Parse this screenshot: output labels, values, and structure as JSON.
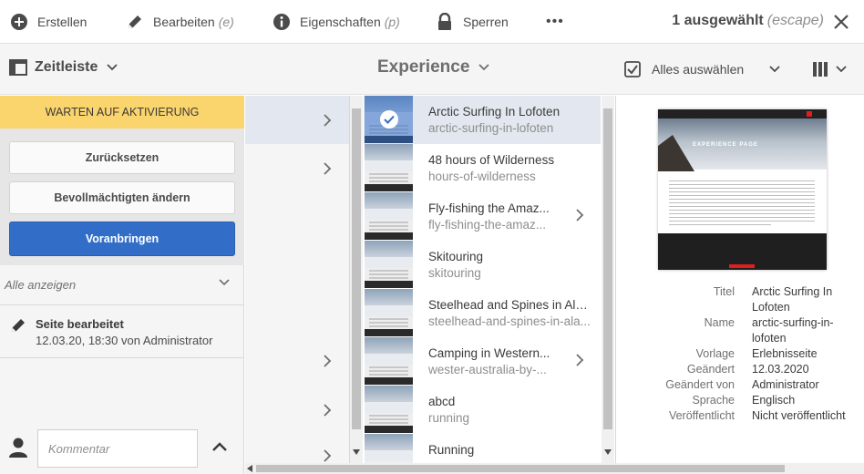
{
  "actions": {
    "create": "Erstellen",
    "edit": "Bearbeiten",
    "edit_shortcut": "(e)",
    "properties": "Eigenschaften",
    "properties_shortcut": "(p)",
    "lock": "Sperren",
    "more": "•••",
    "selection_count": "1 ausgewählt",
    "selection_shortcut": "(escape)"
  },
  "toolbar": {
    "rail_label": "Zeitleiste",
    "title": "Experience",
    "select_all": "Alles auswählen"
  },
  "workflow": {
    "status": "WARTEN AUF AKTIVIERUNG",
    "buttons": [
      "Zurücksetzen",
      "Bevollmächtigten ändern",
      "Voranbringen"
    ]
  },
  "timeline": {
    "filter": "Alle anzeigen",
    "event_title": "Seite bearbeitet",
    "event_detail": "12.03.20, 18:30 von Administrator",
    "comment_placeholder": "Kommentar"
  },
  "pages": [
    {
      "title": "Arctic Surfing In Lofoten",
      "name": "arctic-surfing-in-lofoten",
      "selected": true,
      "has_children": false
    },
    {
      "title": "48 hours of Wilderness",
      "name": "hours-of-wilderness",
      "selected": false,
      "has_children": false
    },
    {
      "title": "Fly-fishing the Amaz...",
      "name": "fly-fishing-the-amaz...",
      "selected": false,
      "has_children": true
    },
    {
      "title": "Skitouring",
      "name": "skitouring",
      "selected": false,
      "has_children": false
    },
    {
      "title": "Steelhead and Spines in Ala...",
      "name": "steelhead-and-spines-in-ala...",
      "selected": false,
      "has_children": false
    },
    {
      "title": "Camping in Western...",
      "name": "wester-australia-by-...",
      "selected": false,
      "has_children": true
    },
    {
      "title": "abcd",
      "name": "running",
      "selected": false,
      "has_children": false
    },
    {
      "title": "Running",
      "name": "",
      "selected": false,
      "has_children": false
    }
  ],
  "preview": {
    "hero_title": "EXPERIENCE PAGE"
  },
  "properties": [
    {
      "key": "Titel",
      "value": "Arctic Surfing In"
    },
    {
      "key": "",
      "value": "Lofoten"
    },
    {
      "key": "Name",
      "value": "arctic-surfing-in-"
    },
    {
      "key": "",
      "value": "lofoten"
    },
    {
      "key": "Vorlage",
      "value": "Erlebnisseite"
    },
    {
      "key": "Geändert",
      "value": "12.03.2020"
    },
    {
      "key": "Geändert von",
      "value": "Administrator"
    },
    {
      "key": "Sprache",
      "value": "Englisch"
    },
    {
      "key": "Veröffentlicht",
      "value": "Nicht veröffentlicht"
    }
  ],
  "colors": {
    "workflow_header": "#fad46d",
    "primary_button": "#326ec8",
    "selection": "#e3e8f0"
  }
}
